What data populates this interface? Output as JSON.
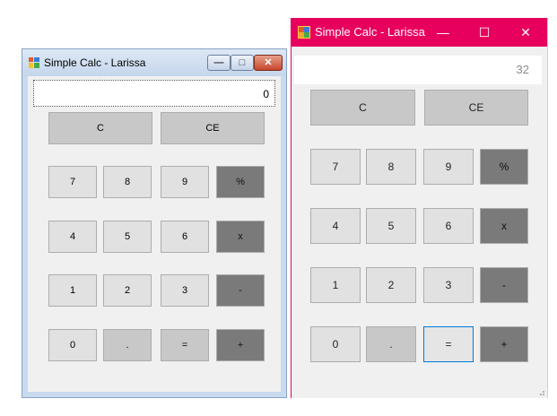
{
  "colors": {
    "win7_title_gradient": "#c5d6ec",
    "win10_title": "#e8005e",
    "button_light": "#e1e1e1",
    "button_gray": "#c8c8c8",
    "button_dark": "#7a7a7a",
    "focus_border": "#0078d7"
  },
  "window_left": {
    "title": "Simple Calc - Larissa",
    "display_value": "0",
    "controls": {
      "minimize": "—",
      "maximize": "□",
      "close": "✕"
    }
  },
  "window_right": {
    "title": "Simple Calc - Larissa",
    "display_value": "32",
    "controls": {
      "minimize": "—",
      "maximize": "☐",
      "close": "✕"
    }
  },
  "keys": {
    "clear": "C",
    "clear_entry": "CE",
    "seven": "7",
    "eight": "8",
    "nine": "9",
    "percent": "%",
    "four": "4",
    "five": "5",
    "six": "6",
    "multiply": "x",
    "one": "1",
    "two": "2",
    "three": "3",
    "minus": "-",
    "zero": "0",
    "decimal": ".",
    "equals": "=",
    "plus": "+"
  },
  "icons": {
    "app": "app-window-icon",
    "minimize": "minimize-icon",
    "maximize": "maximize-icon",
    "close": "close-icon",
    "grip": "resize-grip-icon"
  }
}
